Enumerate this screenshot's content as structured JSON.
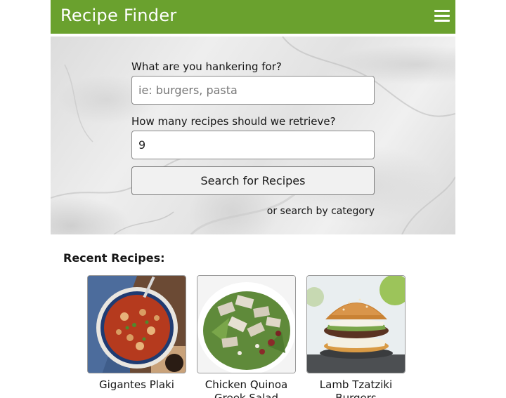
{
  "header": {
    "title": "Recipe Finder",
    "menu_icon": "hamburger-menu-icon"
  },
  "search": {
    "query_label": "What are you hankering for?",
    "query_placeholder": "ie: burgers, pasta",
    "query_value": "",
    "count_label": "How many recipes should we retrieve?",
    "count_value": "9",
    "submit_label": "Search for Recipes",
    "category_link": "or search by category"
  },
  "recent": {
    "heading": "Recent Recipes:",
    "items": [
      {
        "title": "Gigantes Plaki",
        "image": "baked-beans-in-tomato-sauce-photo"
      },
      {
        "title": "Chicken Quinoa Greek Salad",
        "image": "chicken-salad-photo"
      },
      {
        "title": "Lamb Tzatziki Burgers",
        "image": "lamb-burger-photo"
      }
    ]
  },
  "colors": {
    "header_bg": "#6aa12e",
    "header_text": "#ffffff"
  }
}
